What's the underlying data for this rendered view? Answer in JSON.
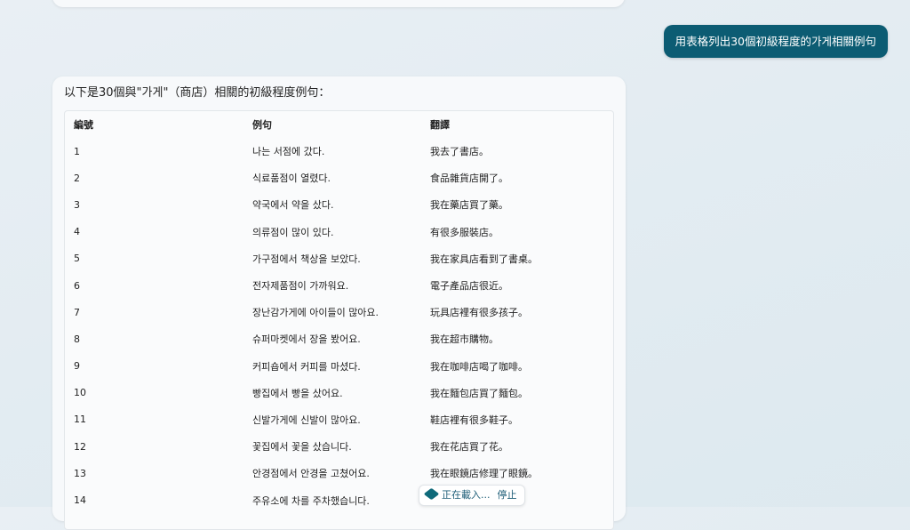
{
  "user_message": "用表格列出30個初級程度的가게相關例句",
  "reply": {
    "intro": "以下是30個與\"가게\"（商店）相關的初級程度例句：",
    "table": {
      "headers": [
        "編號",
        "例句",
        "翻譯"
      ],
      "rows": [
        [
          "1",
          "나는 서점에 갔다.",
          "我去了書店。"
        ],
        [
          "2",
          "식료품점이 열렸다.",
          "食品雜貨店開了。"
        ],
        [
          "3",
          "약국에서 약을 샀다.",
          "我在藥店買了藥。"
        ],
        [
          "4",
          "의류점이 많이 있다.",
          "有很多服裝店。"
        ],
        [
          "5",
          "가구점에서 책상을 보았다.",
          "我在家具店看到了書桌。"
        ],
        [
          "6",
          "전자제품점이 가까워요.",
          "電子產品店很近。"
        ],
        [
          "7",
          "장난감가게에 아이들이 많아요.",
          "玩具店裡有很多孩子。"
        ],
        [
          "8",
          "슈퍼마켓에서 장을 봤어요.",
          "我在超市購物。"
        ],
        [
          "9",
          "커피숍에서 커피를 마셨다.",
          "我在咖啡店喝了咖啡。"
        ],
        [
          "10",
          "빵집에서 빵을 샀어요.",
          "我在麵包店買了麵包。"
        ],
        [
          "11",
          "신발가게에 신발이 많아요.",
          "鞋店裡有很多鞋子。"
        ],
        [
          "12",
          "꽃집에서 꽃을 샀습니다.",
          "我在花店買了花。"
        ],
        [
          "13",
          "안경점에서 안경을 고쳤어요.",
          "我在眼鏡店修理了眼鏡。"
        ],
        [
          "14",
          "주유소에 차를 주차했습니다.",
          ""
        ]
      ]
    }
  },
  "status": {
    "loading_label": "正在載入...",
    "stop_label": "停止",
    "icon": "loading-icon"
  },
  "colors": {
    "user_bubble": "#0c5c73",
    "card_bg": "#f7f9fb",
    "page_bg": "#e6eef3"
  }
}
